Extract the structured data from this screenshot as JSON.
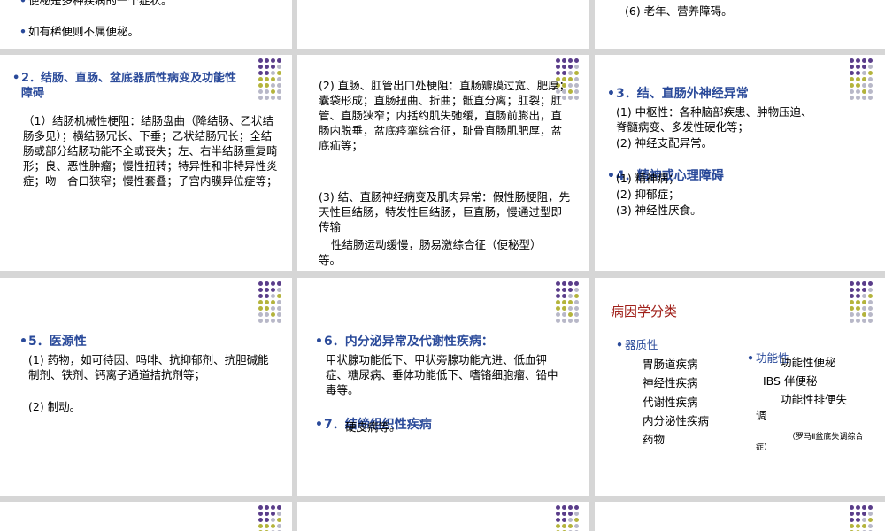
{
  "s1": {
    "b1": "便秘是多种疾病的一个症状。",
    "b2": "如有稀便则不属便秘。"
  },
  "s3": {
    "l1": "(6) 老年、营养障碍。"
  },
  "s4": {
    "title1": "2．结肠、直肠、盆底器质性病变及功能性",
    "title2": "障碍",
    "body": "（1）结肠机械性梗阻：结肠盘曲（降结肠、乙状结肠多见）；横结肠冗长、下垂；乙状结肠冗长；全结肠或部分结肠功能不全或丧失；左、右半结肠重复畸形；良、恶性肿瘤；慢性扭转；特异性和非特异性炎症；吻　合口狭窄；慢性套叠；子宫内膜异位症等；"
  },
  "s5": {
    "p1": "(2) 直肠、肛管出口处梗阻：直肠瓣膜过宽、肥厚；囊袋形成；直肠扭曲、折曲；骶直分离；肛裂；肛管、直肠狭窄；内括约肌失弛缓，直肠前膨出，直肠内脱垂，盆底痉挛综合征，耻骨直肠肌肥厚，盆底疝等；",
    "p2": "(3) 结、直肠神经病变及肌肉异常：假性肠梗阻，先天性巨结肠，特发性巨结肠，巨直肠，慢通过型即传输",
    "p3": "性结肠运动缓慢，肠易激综合征（便秘型）等。"
  },
  "s6": {
    "t3": "3．结、直肠外神经异常",
    "a1": "(1) 中枢性：各种脑部疾患、肿物压迫、",
    "a2": "脊髓病变、多发性硬化等；",
    "a3": "(2) 神经支配异常。",
    "t4": "4．精神或心理障碍",
    "b1": "(1) 精神病；",
    "b2": "(2) 抑郁症；",
    "b3": "(3) 神经性厌食。"
  },
  "s7": {
    "t5": "5．医源性",
    "l1": "(1) 药物，如可待因、吗啡、抗抑郁剂、抗胆碱能制剂、铁剂、钙离子通道拮抗剂等；",
    "l2": "(2) 制动。"
  },
  "s8": {
    "t6": "6．内分泌异常及代谢性疾病：",
    "l1": "甲状腺功能低下、甲状旁腺功能亢进、低血钾症、糖尿病、垂体功能低下、嗜铬细胞瘤、铅中毒等。",
    "t7": "7．结缔组织性疾病",
    "l2": "硬皮病等。"
  },
  "s9": {
    "title": "病因学分类",
    "org": "器质性",
    "o1": "胃肠道疾病",
    "o2": "神经性疾病",
    "o3": "代谢性疾病",
    "o4": "内分泌性疾病",
    "o5": "药物",
    "func": "功能性",
    "f1": "功能性便秘",
    "f2": "IBS 伴便秘",
    "f3": "功能性排便失",
    "f3b": "调",
    "note": "（罗马Ⅱ盆底失调综合",
    "note2": "症）"
  },
  "colors": {
    "purple": "#5a3d8a",
    "olive": "#b4b43c",
    "gray": "#b8b8c8",
    "blue": "#2a4a9a",
    "red": "#a0201a"
  }
}
